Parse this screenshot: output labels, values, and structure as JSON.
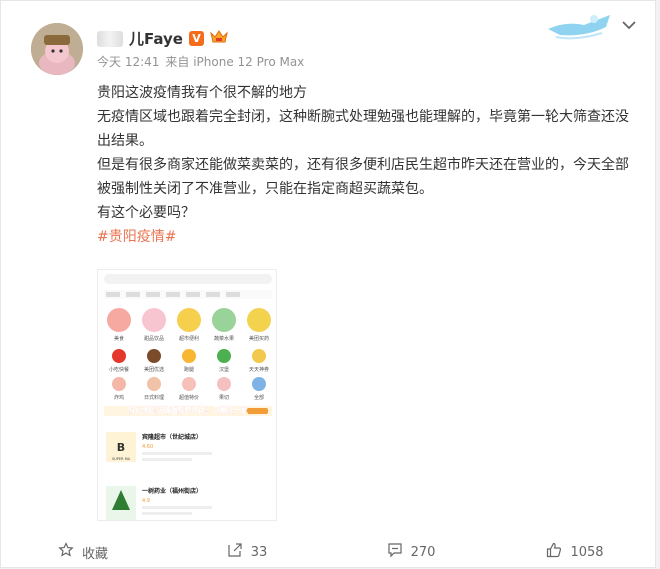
{
  "post": {
    "author": {
      "name": "儿Faye",
      "verified": "V",
      "avatar": "avatar"
    },
    "time": "今天 12:41",
    "source": "来自 iPhone 12 Pro Max",
    "paragraphs": [
      "贵阳这波疫情我有个很不解的地方",
      "无疫情区域也跟着完全封闭，这种断腕式处理勉强也能理解的，毕竟第一轮大筛查还没出结果。",
      "但是有很多商家还能做菜卖菜的，还有很多便利店民生超市昨天还在营业的，今天全部被强制性关闭了不准营业，只能在指定商超买蔬菜包。",
      "有这个必要吗？"
    ],
    "hashtag": "#贵阳疫情#"
  },
  "image": {
    "grid_labels": [
      "美食",
      "甜品饮品",
      "超市便利",
      "蔬菜水果",
      "美团买药",
      "小吃快餐",
      "美团优选",
      "跑腿",
      "汉堡",
      "天天神券",
      "炸鸡",
      "日式料理",
      "超值特价",
      "果切",
      "全部"
    ],
    "overlay": "附近美团店铺强制性关闭，只剩这一家",
    "stores": [
      {
        "name": "宾隆超市（世纪城店）",
        "rating": "4.60",
        "brand": "宾隆超市",
        "sub": "SUPER MA"
      },
      {
        "name": "一树药业（福州街店）",
        "rating": "4.9",
        "brand": "一树药业",
        "sub": "YISHU"
      }
    ]
  },
  "footer": {
    "favorite": "收藏",
    "repost": "33",
    "comment": "270",
    "like": "1058"
  },
  "colors": {
    "hashtag": "#eb7350",
    "meta": "#939393",
    "text": "#333333"
  }
}
